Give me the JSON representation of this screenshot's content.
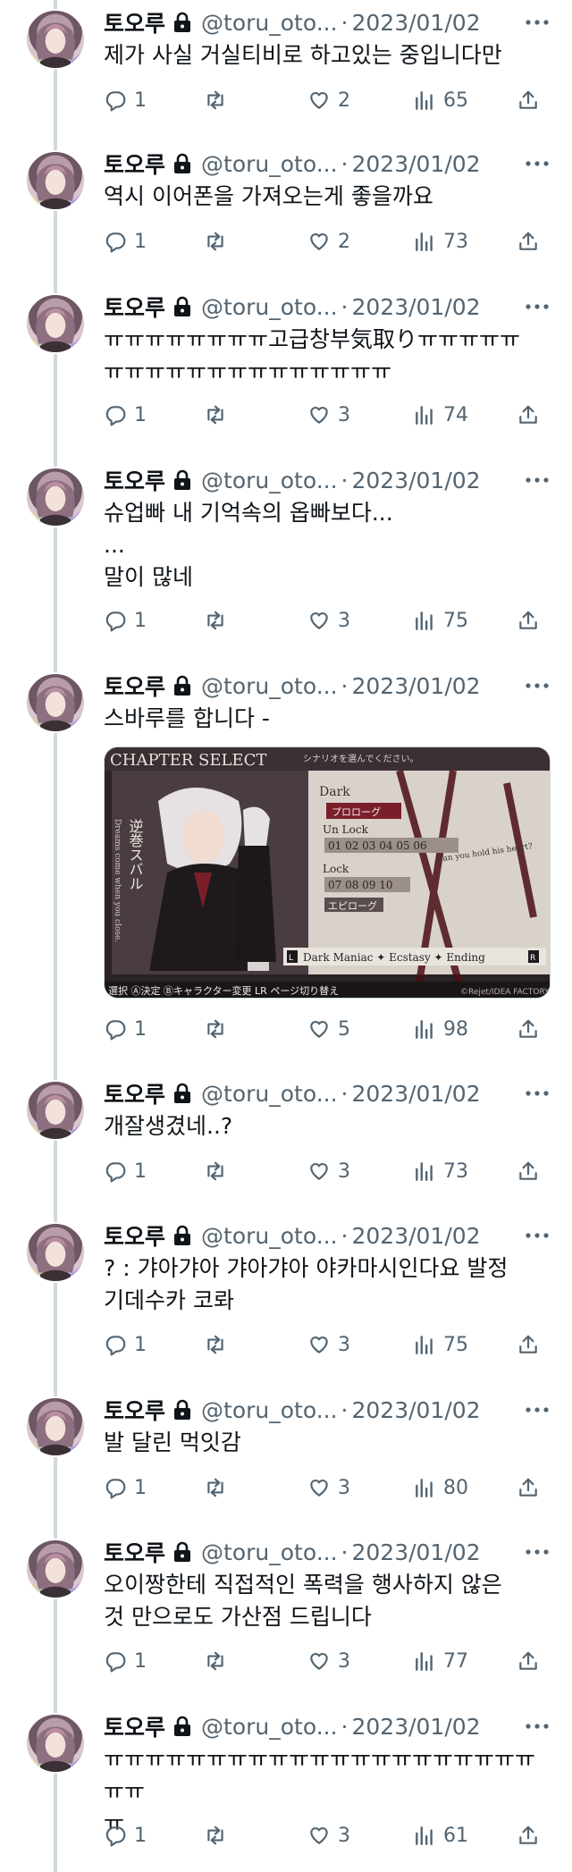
{
  "tweets": [
    {
      "name": "토오루",
      "handle": "@toru_oto...",
      "sep": "·",
      "date": "2023/01/02",
      "text": "제가 사실 거실티비로 하고있는 중입니다만",
      "replies": "1",
      "likes": "2",
      "views": "65"
    },
    {
      "name": "토오루",
      "handle": "@toru_oto...",
      "sep": "·",
      "date": "2023/01/02",
      "text": "역시 이어폰을 가져오는게 좋을까요",
      "replies": "1",
      "likes": "2",
      "views": "73"
    },
    {
      "name": "토오루",
      "handle": "@toru_oto...",
      "sep": "·",
      "date": "2023/01/02",
      "text": "ㅠㅠㅠㅠㅠㅠㅠㅠ고급창부気取りㅠㅠㅠㅠㅠ\nㅠㅠㅠㅠㅠㅠㅠㅠㅠㅠㅠㅠㅠㅠ",
      "replies": "1",
      "likes": "3",
      "views": "74"
    },
    {
      "name": "토오루",
      "handle": "@toru_oto...",
      "sep": "·",
      "date": "2023/01/02",
      "text": "슈업빠 내 기억속의 옵빠보다...\n...\n말이 많네",
      "replies": "1",
      "likes": "3",
      "views": "75"
    },
    {
      "name": "토오루",
      "handle": "@toru_oto...",
      "sep": "·",
      "date": "2023/01/02",
      "text": "스바루를 합니다 -",
      "replies": "1",
      "likes": "5",
      "views": "98",
      "media": {
        "header": "CHAPTER SELECT",
        "header_sub": "シナリオを選んでください。",
        "route": "Dark",
        "prologue": "プロローグ",
        "unlock": "Un Lock",
        "unlock_nums": "01 02 03 04 05 06",
        "lock": "Lock",
        "lock_nums": "07 08 09 10",
        "epilogue": "エピローグ",
        "tagline": "Can you hold his heart?",
        "vertical_title": "逆巻スバル",
        "vertical_sub": "Dreams come when you close.",
        "tabs": "Dark    Maniac ✦ Ecstasy ✦ Ending",
        "tab_l": "L",
        "tab_r": "R",
        "footer": "選択 Ⓐ決定 Ⓑキャラクター変更 LR ページ切り替え",
        "footer_copy": "©Rejet/IDEA FACTORY"
      }
    },
    {
      "name": "토오루",
      "handle": "@toru_oto...",
      "sep": "·",
      "date": "2023/01/02",
      "text": "개잘생겼네..?",
      "replies": "1",
      "likes": "3",
      "views": "73"
    },
    {
      "name": "토오루",
      "handle": "@toru_oto...",
      "sep": "·",
      "date": "2023/01/02",
      "text": "? : 갸아갸아 갸아갸아 야카마시인다요 발정\n기데수카 코롸",
      "replies": "1",
      "likes": "3",
      "views": "75"
    },
    {
      "name": "토오루",
      "handle": "@toru_oto...",
      "sep": "·",
      "date": "2023/01/02",
      "text": "발 달린 먹잇감",
      "replies": "1",
      "likes": "3",
      "views": "80"
    },
    {
      "name": "토오루",
      "handle": "@toru_oto...",
      "sep": "·",
      "date": "2023/01/02",
      "text": "오이짱한테 직접적인 폭력을 행사하지 않은\n것 만으로도 가산점 드립니다",
      "replies": "1",
      "likes": "3",
      "views": "77"
    },
    {
      "name": "토오루",
      "handle": "@toru_oto...",
      "sep": "·",
      "date": "2023/01/02",
      "text": "ㅠㅠㅠㅠㅠㅠㅠㅠㅠㅠㅠㅠㅠㅠㅠㅠㅠㅠㅠㅠㅠㅠㅠ\nㅠ",
      "replies": "1",
      "likes": "3",
      "views": "61"
    }
  ],
  "icons": {
    "avatar": "avatar-icon",
    "lock": "lock-icon",
    "more": "more-icon",
    "reply": "reply-icon",
    "retweet": "retweet-icon",
    "like": "heart-icon",
    "views": "views-icon",
    "share": "share-icon"
  },
  "colors": {
    "text": "#0f1419",
    "muted": "#536471",
    "thread_line": "#cfd9de"
  }
}
